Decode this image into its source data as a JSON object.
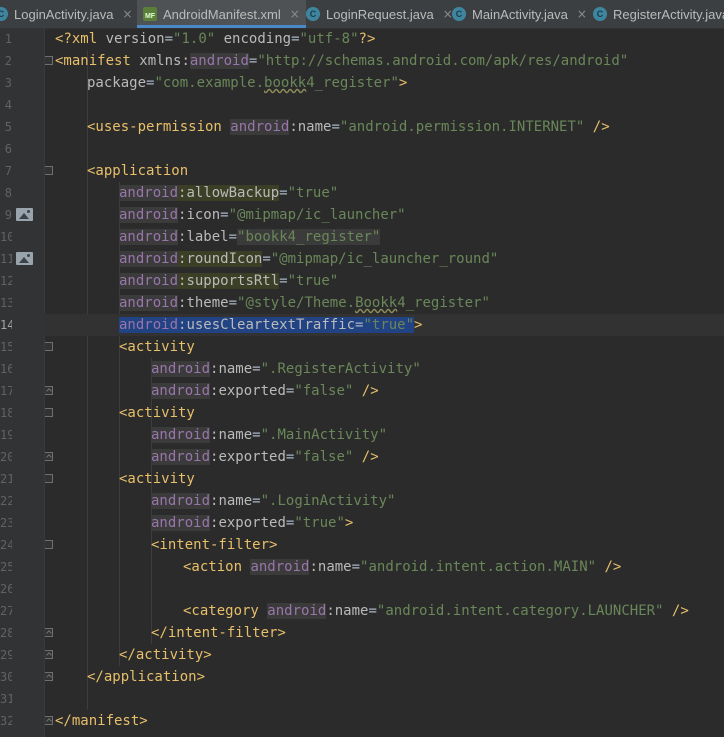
{
  "tabs": [
    {
      "label": "LoginActivity.java",
      "active": false,
      "icon": "java-class-icon"
    },
    {
      "label": "AndroidManifest.xml",
      "active": true,
      "icon": "manifest-icon"
    },
    {
      "label": "LoginRequest.java",
      "active": false,
      "icon": "java-class-icon"
    },
    {
      "label": "MainActivity.java",
      "active": false,
      "icon": "java-class-icon"
    },
    {
      "label": "RegisterActivity.java",
      "active": false,
      "icon": "java-class-icon"
    }
  ],
  "tab_close_glyph": "×",
  "line_numbers": [
    "1",
    "2",
    "3",
    "4",
    "5",
    "6",
    "7",
    "8",
    "9",
    "10",
    "11",
    "12",
    "13",
    "14",
    "15",
    "16",
    "17",
    "18",
    "19",
    "20",
    "21",
    "22",
    "23",
    "24",
    "25",
    "26",
    "27",
    "28",
    "29",
    "30",
    "31",
    "32"
  ],
  "current_line": "14",
  "code": {
    "l1": {
      "open": "<?",
      "xml": "xml ",
      "a1": "version",
      "eq1": "=",
      "v1": "\"1.0\"",
      "sp": " ",
      "a2": "encoding",
      "eq2": "=",
      "v2": "\"utf-8\"",
      "close": "?>"
    },
    "l2": {
      "open": "<manifest ",
      "xmlns": "xmlns:",
      "ns": "android",
      "eq": "=",
      "v": "\"http://schemas.android.com/apk/res/android\""
    },
    "l3": {
      "a": "package",
      "eq": "=",
      "v_pre": "\"com.example.",
      "v_typo": "bookk",
      "v_post": "4_register\"",
      "close": ">"
    },
    "l5": {
      "open": "<uses-permission ",
      "ns": "android",
      "colon": ":",
      "a": "name",
      "eq": "=",
      "v": "\"android.permission.INTERNET\"",
      "close": " />"
    },
    "l7": {
      "open": "<application"
    },
    "l8": {
      "ns": "android",
      "colon": ":",
      "a": "allowBackup",
      "eq": "=",
      "v": "\"true\""
    },
    "l9": {
      "ns": "android",
      "colon": ":",
      "a": "icon",
      "eq": "=",
      "v": "\"@mipmap/ic_launcher\""
    },
    "l10": {
      "ns": "android",
      "colon": ":",
      "a": "label",
      "eq": "=",
      "v": "\"bookk4_register\""
    },
    "l11": {
      "ns": "android",
      "colon": ":",
      "a": "roundIcon",
      "eq": "=",
      "v": "\"@mipmap/ic_launcher_round\""
    },
    "l12": {
      "ns": "android",
      "colon": ":",
      "a": "supportsRtl",
      "eq": "=",
      "v": "\"true\""
    },
    "l13": {
      "ns": "android",
      "colon": ":",
      "a": "theme",
      "eq": "=",
      "v_pre": "\"@style/Theme.",
      "v_typo": "Bookk",
      "v_post": "4_register\""
    },
    "l14": {
      "ns": "android",
      "colon": ":",
      "a": "usesCleartextTraffic",
      "eq": "=",
      "v": "\"true\"",
      "close": ">"
    },
    "l15": {
      "open": "<activity"
    },
    "l16": {
      "ns": "android",
      "colon": ":",
      "a": "name",
      "eq": "=",
      "v": "\".RegisterActivity\""
    },
    "l17": {
      "ns": "android",
      "colon": ":",
      "a": "exported",
      "eq": "=",
      "v": "\"false\"",
      "close": " />"
    },
    "l18": {
      "open": "<activity"
    },
    "l19": {
      "ns": "android",
      "colon": ":",
      "a": "name",
      "eq": "=",
      "v": "\".MainActivity\""
    },
    "l20": {
      "ns": "android",
      "colon": ":",
      "a": "exported",
      "eq": "=",
      "v": "\"false\"",
      "close": " />"
    },
    "l21": {
      "open": "<activity"
    },
    "l22": {
      "ns": "android",
      "colon": ":",
      "a": "name",
      "eq": "=",
      "v": "\".LoginActivity\""
    },
    "l23": {
      "ns": "android",
      "colon": ":",
      "a": "exported",
      "eq": "=",
      "v": "\"true\"",
      "close": ">"
    },
    "l24": {
      "open": "<intent-filter>"
    },
    "l25": {
      "open": "<action ",
      "ns": "android",
      "colon": ":",
      "a": "name",
      "eq": "=",
      "v": "\"android.intent.action.MAIN\"",
      "close": " />"
    },
    "l27": {
      "open": "<category ",
      "ns": "android",
      "colon": ":",
      "a": "name",
      "eq": "=",
      "v": "\"android.intent.category.LAUNCHER\"",
      "close": " />"
    },
    "l28": {
      "open": "</intent-filter>"
    },
    "l29": {
      "open": "</activity>"
    },
    "l30": {
      "open": "</application>"
    },
    "l32": {
      "open": "</manifest>"
    }
  },
  "colors": {
    "background": "#2b2b2b",
    "gutter": "#313335",
    "tag": "#e8bf6a",
    "attribute": "#bababa",
    "value": "#6a8759",
    "namespace": "#9876aa",
    "selection": "#214283",
    "tab_active_underline": "#4a88c7"
  }
}
